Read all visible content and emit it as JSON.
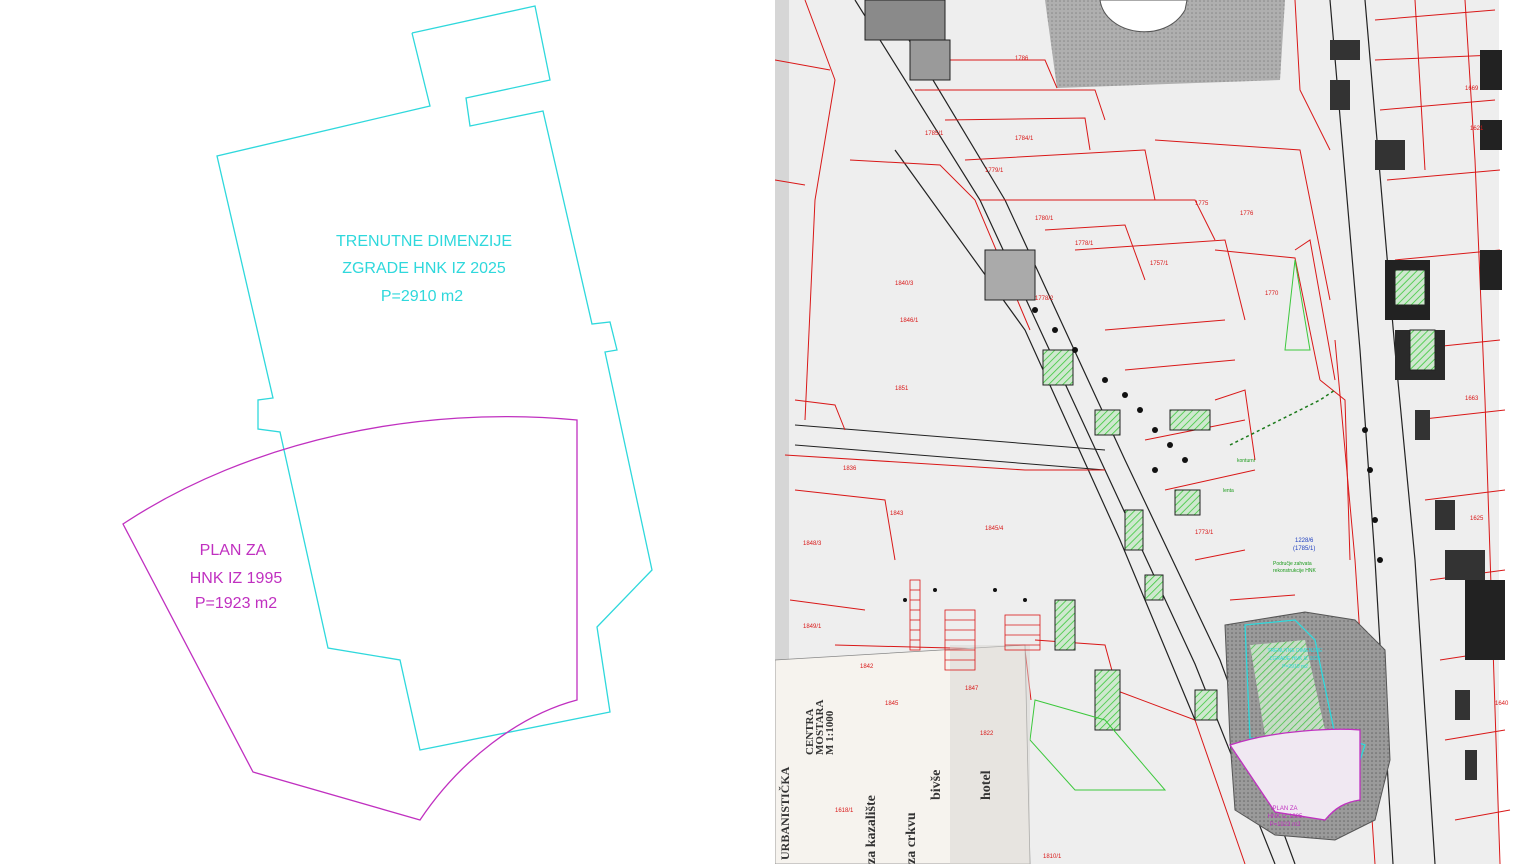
{
  "left_diagram": {
    "current_building": {
      "line1": "TRENUTNE DIMENZIJE",
      "line2": "ZGRADE HNK IZ 2025",
      "area": "P=2910 m2",
      "color": "#2fd8dc"
    },
    "plan_1995": {
      "line1": "PLAN ZA",
      "line2": "HNK IZ 1995",
      "area": "P=1923 m2",
      "color": "#c030c0"
    }
  },
  "cadastral_map": {
    "line_color": "#d91818",
    "overlay_cyan": "#2fd8dc",
    "overlay_magenta": "#c030c0",
    "green_color": "#3cc83c",
    "parcel_numbers": [
      "1785/1",
      "1786",
      "1784/1",
      "1779/1",
      "1780/1",
      "1778/1",
      "1778/2",
      "1757/1",
      "1775",
      "1776",
      "1770",
      "1669",
      "1621",
      "1625",
      "1840/3",
      "1846/1",
      "1842",
      "1845",
      "1851",
      "1848/3",
      "1849/1",
      "1836",
      "1843",
      "1847",
      "1822",
      "1845/4",
      "1773/1",
      "1228/6",
      "1810/1",
      "1618/1",
      "1640",
      "1663"
    ],
    "green_notes": [
      "konturni",
      "lenta"
    ],
    "blue_note_1": "1228/6",
    "blue_note_2": "(1785/1)",
    "blue_caption": "Područje zahvata",
    "blue_caption_2": "rekonstrukcije HNK",
    "cyan_caption_1": "TRENUTNE DIMENZIJE",
    "cyan_caption_2": "ZGRADE HNK IZ 2025",
    "cyan_caption_3": "P=2910 m2",
    "mini_plan_1": "PLAN ZA",
    "mini_plan_2": "HNK IZ 1995",
    "mini_plan_3": "P=1923 m2",
    "print_text_1": "URBANISTIČKA",
    "print_text_2": "CENTRA",
    "print_text_3": "MOSTARA",
    "print_text_4": "M 1:1000",
    "print_text_5": "za kazalište",
    "print_text_6": "za crkvu",
    "print_text_7": "bivše",
    "print_text_8": "hotel"
  }
}
